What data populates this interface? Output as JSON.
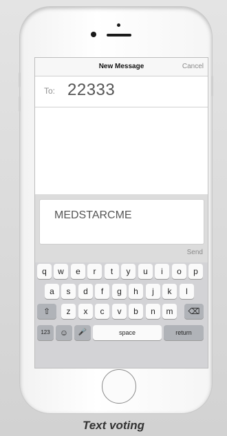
{
  "nav": {
    "title": "New Message",
    "cancel_label": "Cancel"
  },
  "recipient": {
    "label": "To:",
    "value": "22333"
  },
  "message": {
    "text": "MEDSTARCME",
    "send_label": "Send"
  },
  "keyboard": {
    "row1": [
      "q",
      "w",
      "e",
      "r",
      "t",
      "y",
      "u",
      "i",
      "o",
      "p"
    ],
    "row2": [
      "a",
      "s",
      "d",
      "f",
      "g",
      "h",
      "j",
      "k",
      "l"
    ],
    "row3": [
      "z",
      "x",
      "c",
      "v",
      "b",
      "n",
      "m"
    ],
    "shift": "⇧",
    "backspace": "⌫",
    "numbers": "123",
    "emoji": "☺",
    "mic": "🎤",
    "space": "space",
    "return": "return"
  },
  "caption": "Text voting"
}
